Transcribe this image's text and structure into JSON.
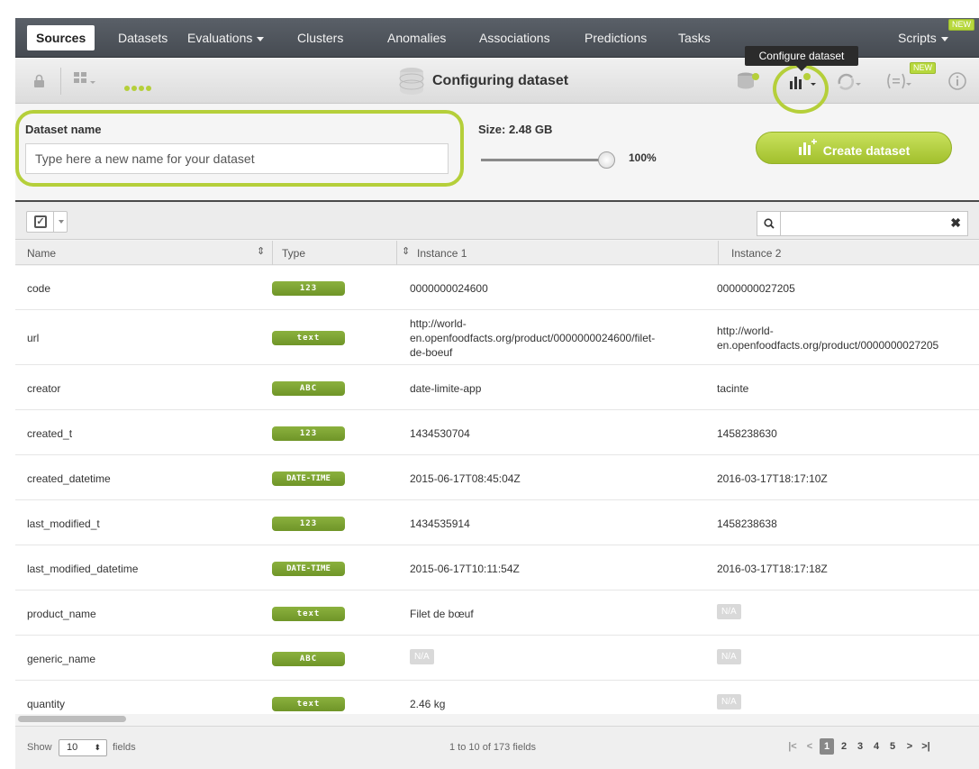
{
  "nav": {
    "items": [
      "Sources",
      "Datasets",
      "Evaluations",
      "Clusters",
      "Anomalies",
      "Associations",
      "Predictions",
      "Tasks"
    ],
    "scripts": "Scripts",
    "new_badge": "NEW"
  },
  "tooltip": "Configure dataset",
  "toolbar": {
    "title": "Configuring dataset",
    "new_badge": "NEW"
  },
  "config": {
    "name_label": "Dataset name",
    "name_placeholder": "Type here a new name for your dataset",
    "size_label": "Size: 2.48 GB",
    "sample_pct": "100%",
    "sample_level": 1.0,
    "create_label": "Create dataset"
  },
  "table": {
    "columns": [
      "Name",
      "Type",
      "Instance 1",
      "Instance 2"
    ],
    "rows": [
      {
        "name": "code",
        "type": "123",
        "i1": "0000000024600",
        "i2": "0000000027205"
      },
      {
        "name": "url",
        "type": "text",
        "i1": [
          "http://world-",
          "en.openfoodfacts.org/product/0000000024600/filet-",
          "de-boeuf"
        ],
        "i2": [
          "http://world-",
          "en.openfoodfacts.org/product/0000000027205"
        ]
      },
      {
        "name": "creator",
        "type": "ABC",
        "i1": "date-limite-app",
        "i2": "tacinte"
      },
      {
        "name": "created_t",
        "type": "123",
        "i1": "1434530704",
        "i2": "1458238630"
      },
      {
        "name": "created_datetime",
        "type": "DATE-TIME",
        "i1": "2015-06-17T08:45:04Z",
        "i2": "2016-03-17T18:17:10Z"
      },
      {
        "name": "last_modified_t",
        "type": "123",
        "i1": "1434535914",
        "i2": "1458238638"
      },
      {
        "name": "last_modified_datetime",
        "type": "DATE-TIME",
        "i1": "2015-06-17T10:11:54Z",
        "i2": "2016-03-17T18:17:18Z"
      },
      {
        "name": "product_name",
        "type": "text",
        "i1": "Filet de bœuf",
        "i2": "N/A"
      },
      {
        "name": "generic_name",
        "type": "ABC",
        "i1": "N/A",
        "i2": "N/A"
      },
      {
        "name": "quantity",
        "type": "text",
        "i1": "2.46 kg",
        "i2": "N/A"
      }
    ]
  },
  "footer": {
    "show_label": "Show",
    "show_value": "10",
    "fields_label": "fields",
    "range": "1 to 10 of 173 fields",
    "pages": [
      "1",
      "2",
      "3",
      "4",
      "5"
    ],
    "current_page": "1"
  },
  "colors": {
    "accent": "#b5cf3a",
    "type_pill": "#7ca232",
    "nav_bg": "#4f555c"
  }
}
